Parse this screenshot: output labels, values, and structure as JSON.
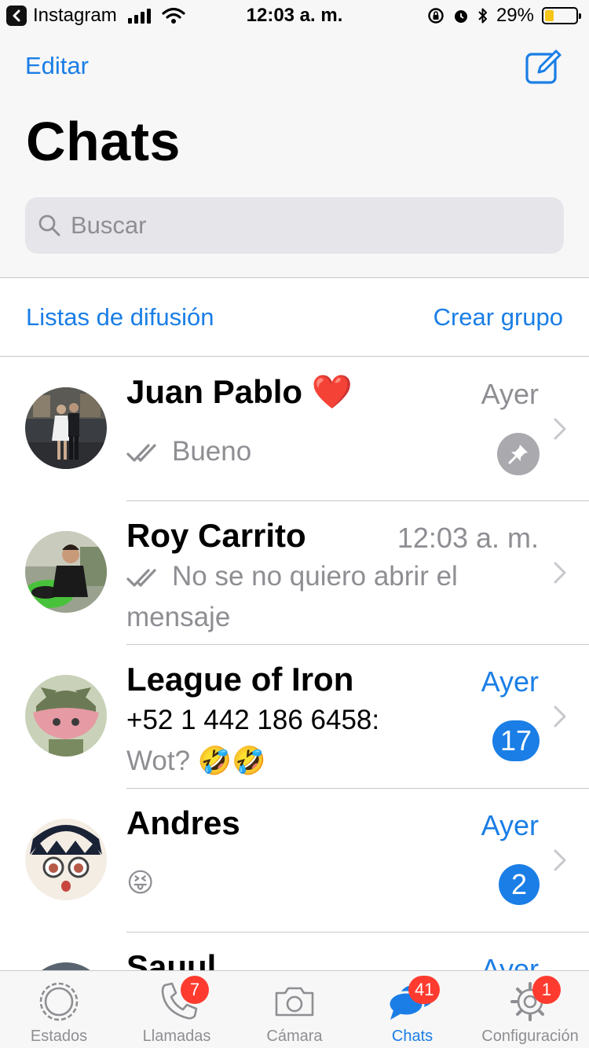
{
  "status_bar": {
    "back_app": "Instagram",
    "time": "12:03 a. m.",
    "battery": "29%",
    "battery_level": 0.29
  },
  "header": {
    "edit_label": "Editar",
    "compose_icon": "compose-icon",
    "title": "Chats",
    "search_placeholder": "Buscar"
  },
  "links": {
    "broadcast": "Listas de difusión",
    "new_group": "Crear grupo"
  },
  "chats": [
    {
      "name": "Juan Pablo",
      "name_emoji": "❤️",
      "time": "Ayer",
      "message": "Bueno",
      "read_ticks": true,
      "pinned": true
    },
    {
      "name": "Roy Carrito",
      "time": "12:03 a. m.",
      "message": "No se no quiero abrir el mensaje",
      "read_ticks": true
    },
    {
      "name": "League of Iron",
      "time": "Ayer",
      "sender": "+52 1 442 186 6458:",
      "message": "Wot? 🤣🤣",
      "unread": "17"
    },
    {
      "name": "Andres",
      "time": "Ayer",
      "message": "😝",
      "unread": "2"
    },
    {
      "name": "Sauul",
      "time": "Ayer"
    }
  ],
  "tabs": [
    {
      "label": "Estados",
      "icon": "status-icon"
    },
    {
      "label": "Llamadas",
      "icon": "phone-icon",
      "badge": "7"
    },
    {
      "label": "Cámara",
      "icon": "camera-icon"
    },
    {
      "label": "Chats",
      "icon": "chats-icon",
      "badge": "41",
      "active": true
    },
    {
      "label": "Configuración",
      "icon": "gear-icon",
      "badge": "1"
    }
  ],
  "colors": {
    "accent": "#1a7ee6",
    "badge_red": "#ff3b30",
    "secondary_text": "#8e8e93"
  }
}
